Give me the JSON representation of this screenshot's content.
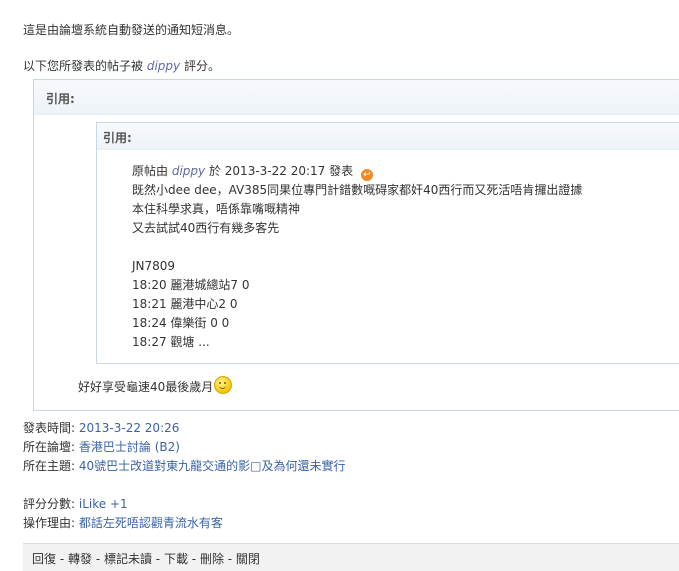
{
  "intro": {
    "line1": "這是由論壇系統自動發送的通知短消息。",
    "line2_prefix": "以下您所發表的帖子被",
    "line2_user": "dippy",
    "line2_suffix": "評分。"
  },
  "outer_quote": {
    "label": "引用:",
    "inner_quote": {
      "label": "引用:",
      "author_prefix": "原帖由",
      "author": "dippy",
      "author_mid": "於 2013-3-22 20:17 發表",
      "go_icon": "arrow-link-icon",
      "lines": [
        "既然小dee dee，AV385同果位專門計錯數嘅碍家都奸40西行而又死活唔肯攞出證據",
        "本住科學求真，唔係靠嘴嘅精神",
        "又去試試40西行有幾多客先",
        "",
        "JN7809",
        "18:20 麗港城總站7 0",
        "18:21 麗港中心2 0",
        "18:24 偉樂街 0 0",
        "18:27 觀塘 ..."
      ]
    },
    "reply_text": "好好享受龜速40最後歲月",
    "reply_icon": "smiley-icon"
  },
  "meta": {
    "post_time_label": "發表時間:",
    "post_time_value": "2013-3-22 20:26",
    "forum_label": "所在論壇:",
    "forum_value": "香港巴士討論 (B2)",
    "topic_label": "所在主題:",
    "topic_value": "40號巴士改道對東九龍交通的影□及為何還未實行"
  },
  "rating": {
    "score_label": "評分分數:",
    "score_value": "iLike +1",
    "reason_label": "操作理由:",
    "reason_value": "都話左死唔認觀青流水有客"
  },
  "footer": {
    "reply": "回復",
    "forward": "轉發",
    "mark_unread": "標記未讀",
    "download": "下載",
    "delete": "刪除",
    "close": "關閉",
    "sep": " - "
  }
}
